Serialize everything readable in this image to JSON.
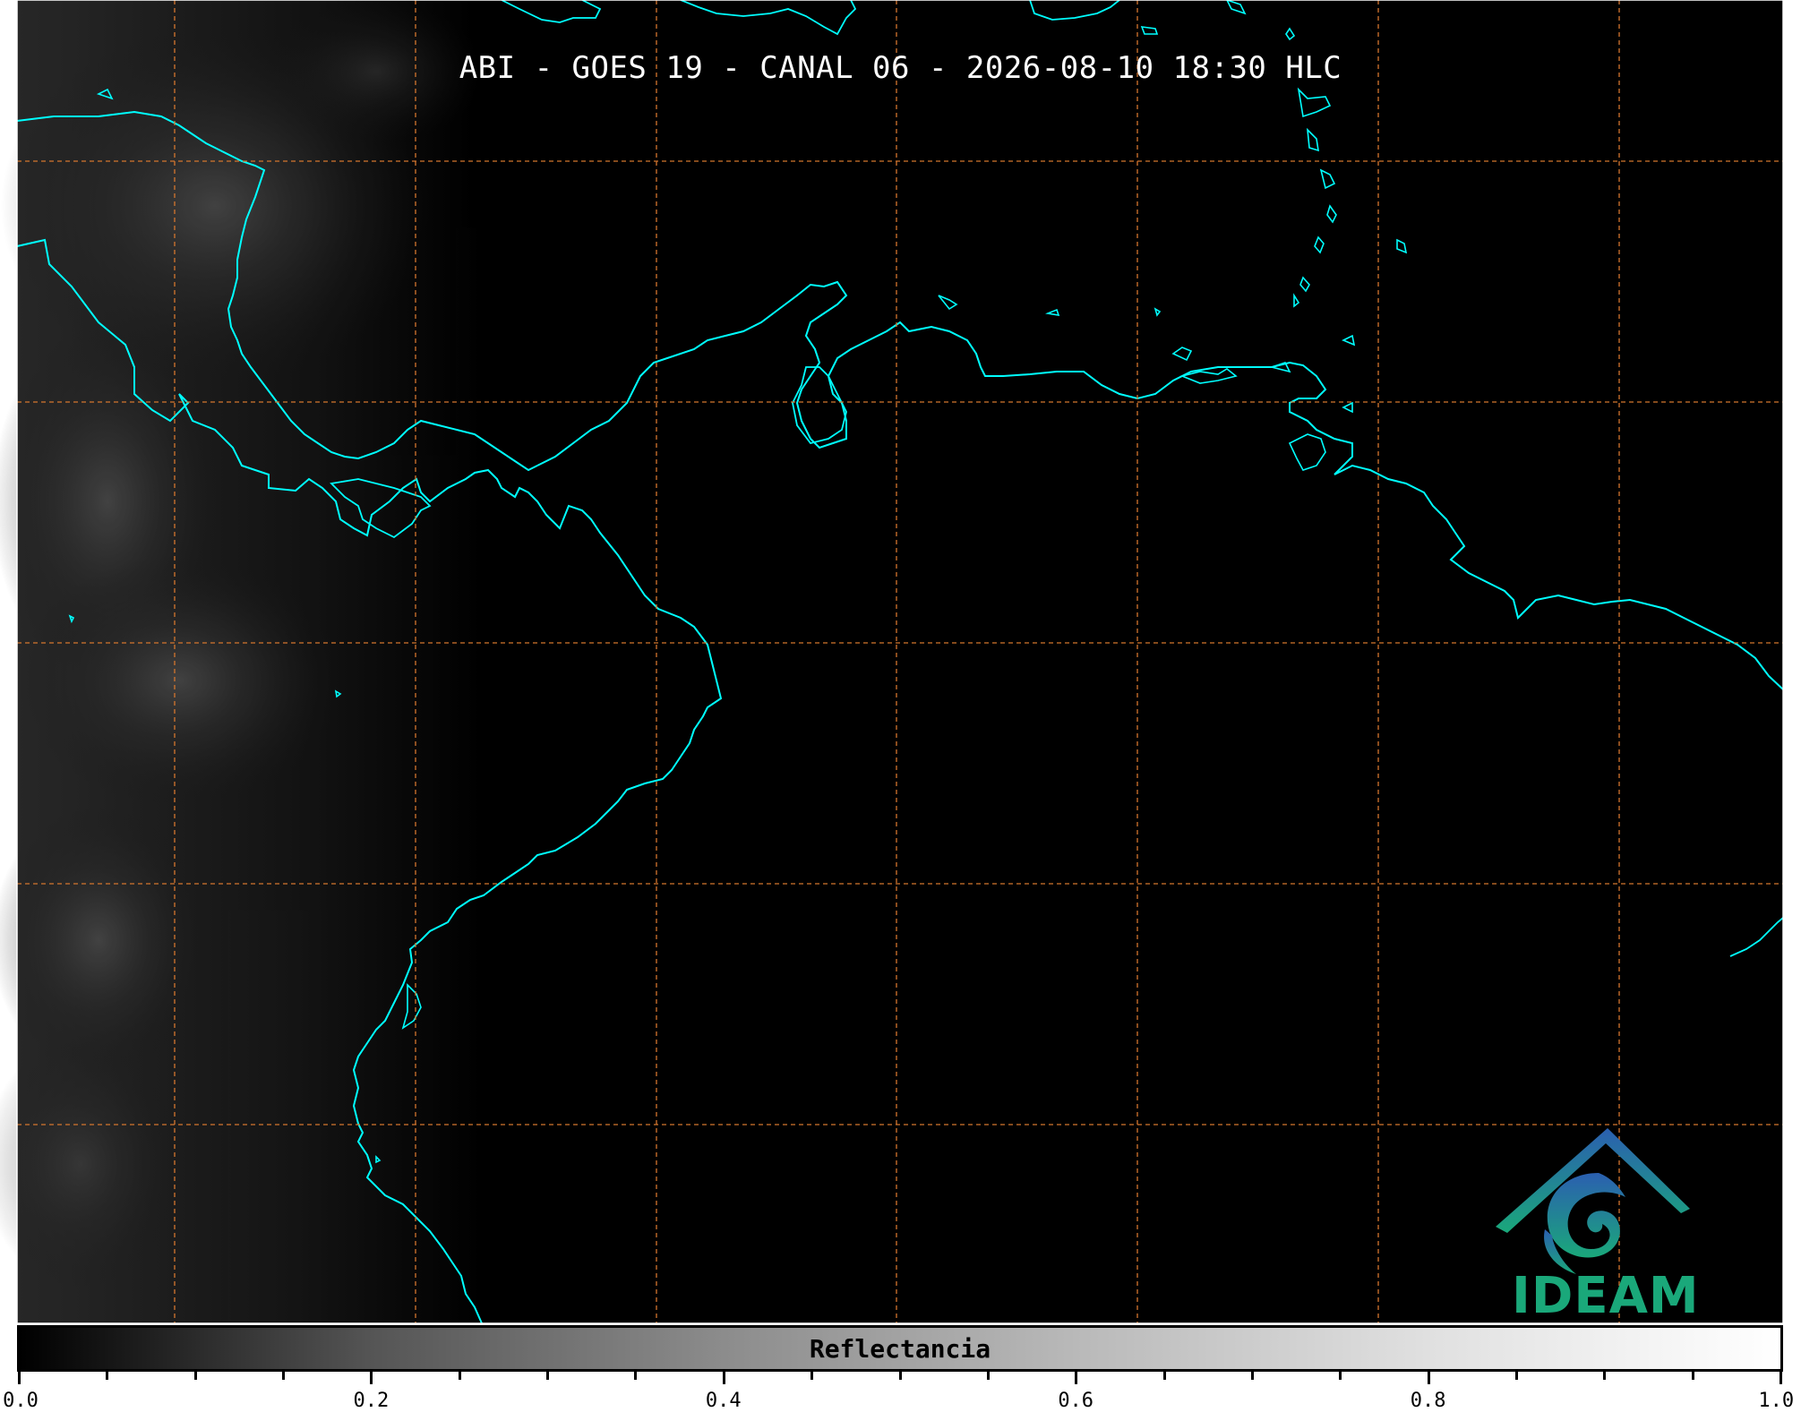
{
  "title": "ABI - GOES 19 - CANAL 06 - 2026-08-10 18:30 HLC",
  "colorbar": {
    "label": "Reflectancia",
    "ticks": [
      "0.0",
      "0.2",
      "0.4",
      "0.6",
      "0.8",
      "1.0"
    ],
    "range": [
      0.0,
      1.0
    ],
    "colors": [
      "#000000",
      "#ffffff"
    ]
  },
  "logo": {
    "text": "IDEAM",
    "color": "#1aa87a"
  },
  "colors": {
    "coastline": "#00ffff",
    "gridlines": "#d4762e",
    "background": "#000000"
  }
}
